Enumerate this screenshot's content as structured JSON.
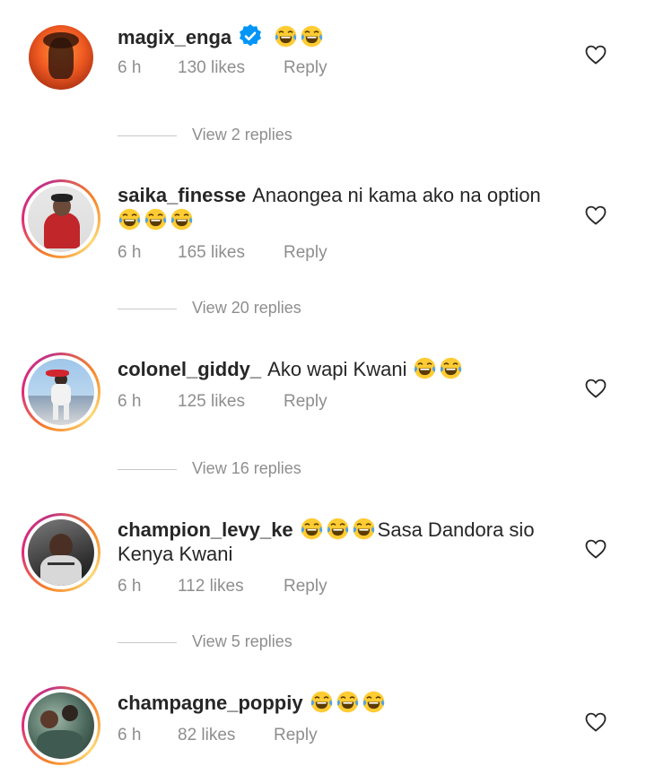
{
  "emoji_name": "face-with-tears-of-joy-icon",
  "colors": {
    "text": "#262626",
    "secondary": "#8e8e8e",
    "verified": "#0095f6"
  },
  "comments": [
    {
      "username": "magix_enga",
      "verified": true,
      "text_before": "",
      "emoji_count": 2,
      "text_after": "",
      "time": "6 h",
      "likes": "130 likes",
      "reply": "Reply",
      "view_replies": "View 2 replies"
    },
    {
      "username": "saika_finesse",
      "verified": false,
      "text_before": "Anaongea ni kama ako na option",
      "emoji_count": 3,
      "text_after": "",
      "time": "6 h",
      "likes": "165 likes",
      "reply": "Reply",
      "view_replies": "View 20 replies"
    },
    {
      "username": "colonel_giddy_",
      "verified": false,
      "text_before": "Ako wapi Kwani",
      "emoji_count": 2,
      "text_after": "",
      "time": "6 h",
      "likes": "125 likes",
      "reply": "Reply",
      "view_replies": "View 16 replies"
    },
    {
      "username": "champion_levy_ke",
      "verified": false,
      "text_before": "",
      "emoji_count": 3,
      "text_after": "Sasa Dandora sio Kenya Kwani",
      "time": "6 h",
      "likes": "112 likes",
      "reply": "Reply",
      "view_replies": "View 5 replies"
    },
    {
      "username": "champagne_poppiy",
      "verified": false,
      "text_before": "",
      "emoji_count": 3,
      "text_after": "",
      "time": "6 h",
      "likes": "82 likes",
      "reply": "Reply",
      "view_replies": ""
    }
  ]
}
